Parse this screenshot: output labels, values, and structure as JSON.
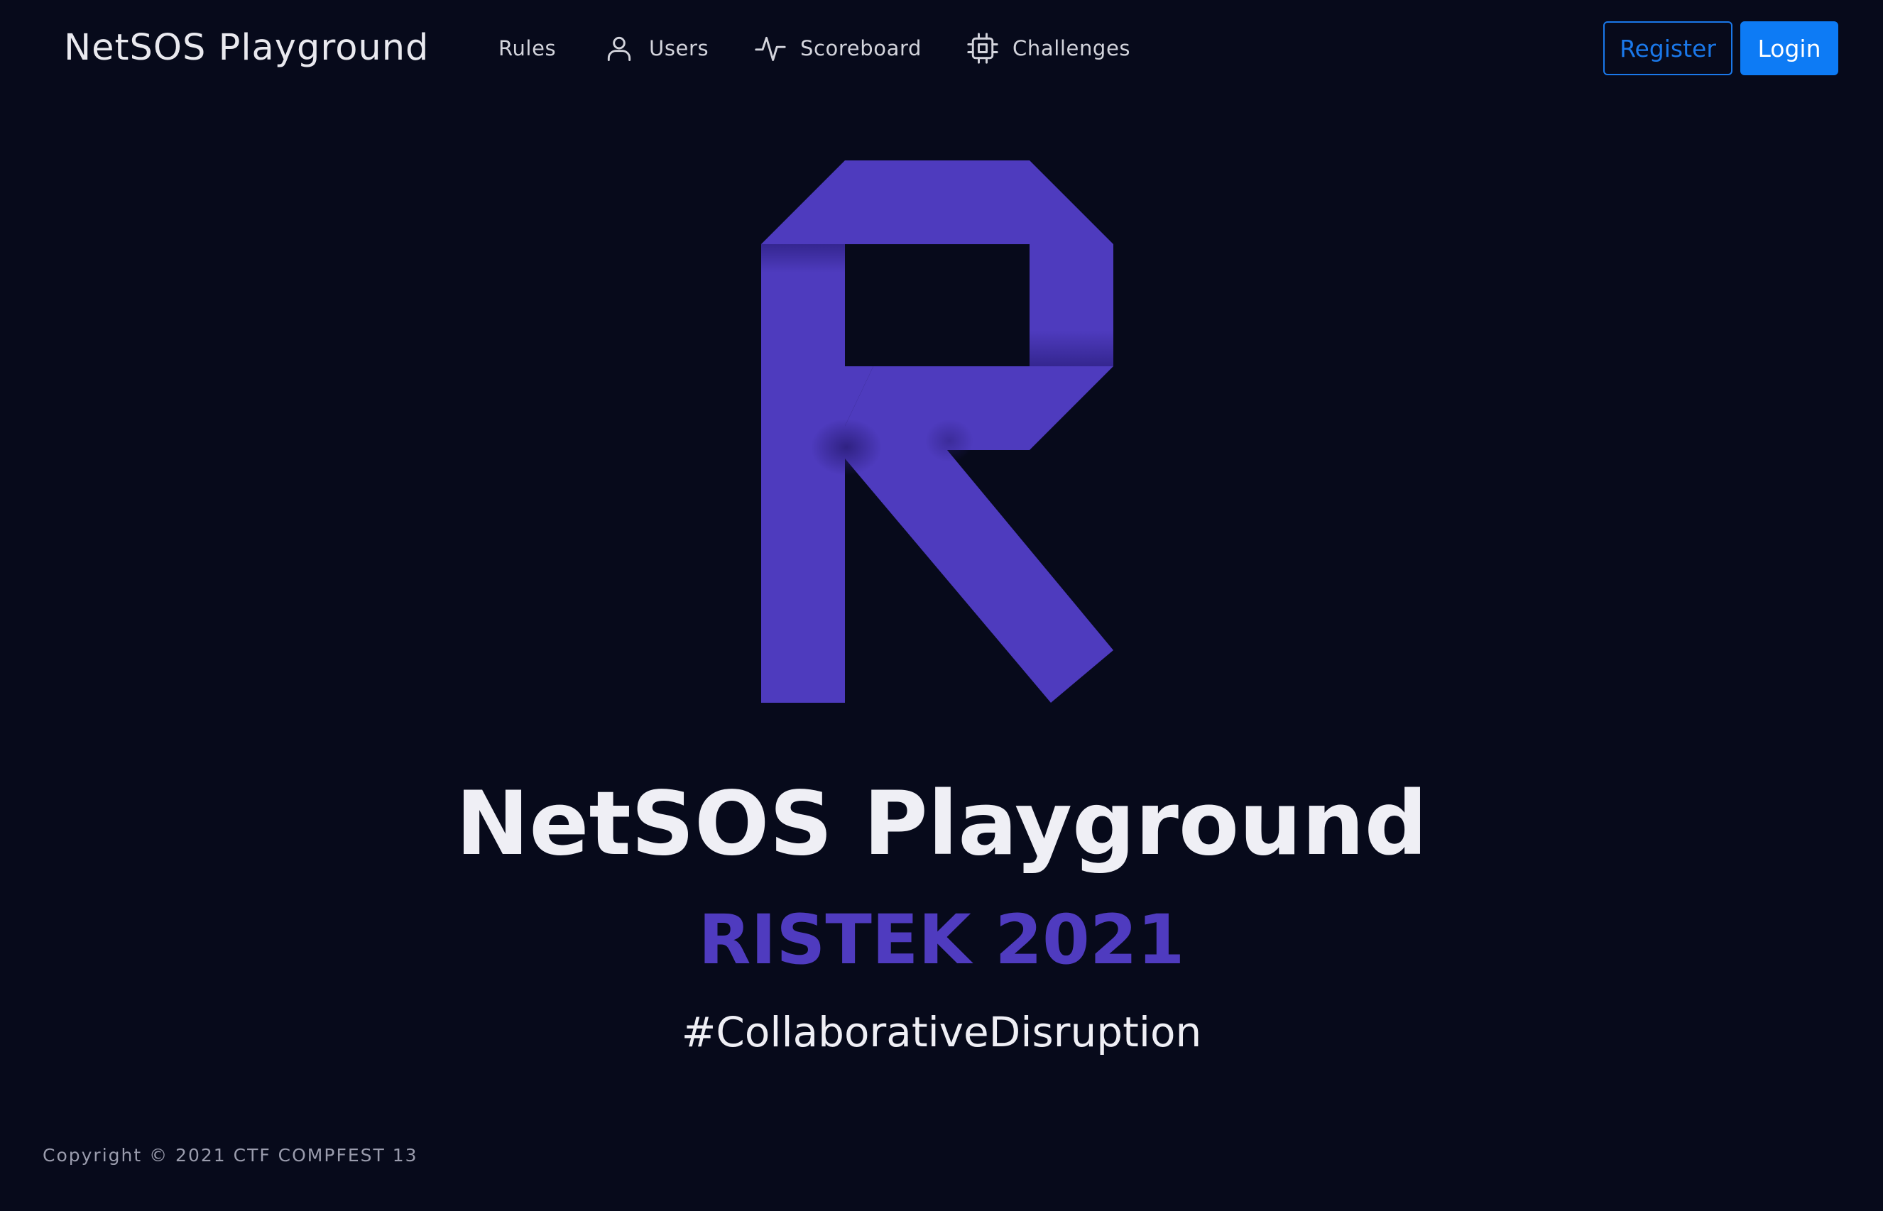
{
  "navbar": {
    "brand": "NetSOS Playground",
    "items": [
      {
        "label": "Rules",
        "icon": "none"
      },
      {
        "label": "Users",
        "icon": "user-icon"
      },
      {
        "label": "Scoreboard",
        "icon": "activity-icon"
      },
      {
        "label": "Challenges",
        "icon": "cpu-chip-icon"
      }
    ],
    "register_label": "Register",
    "login_label": "Login"
  },
  "hero": {
    "logo": "ristek-r-logo",
    "title": "NetSOS Playground",
    "subtitle": "RISTEK 2021",
    "tagline": "#CollaborativeDisruption"
  },
  "footer": {
    "copyright": "Copyright © 2021 CTF COMPFEST 13"
  },
  "colors": {
    "background": "#070a1b",
    "accent_purple": "#4f3bbf",
    "primary_blue": "#0d7bf5",
    "text_light": "#efeff5",
    "text_muted": "#9a9cad"
  }
}
